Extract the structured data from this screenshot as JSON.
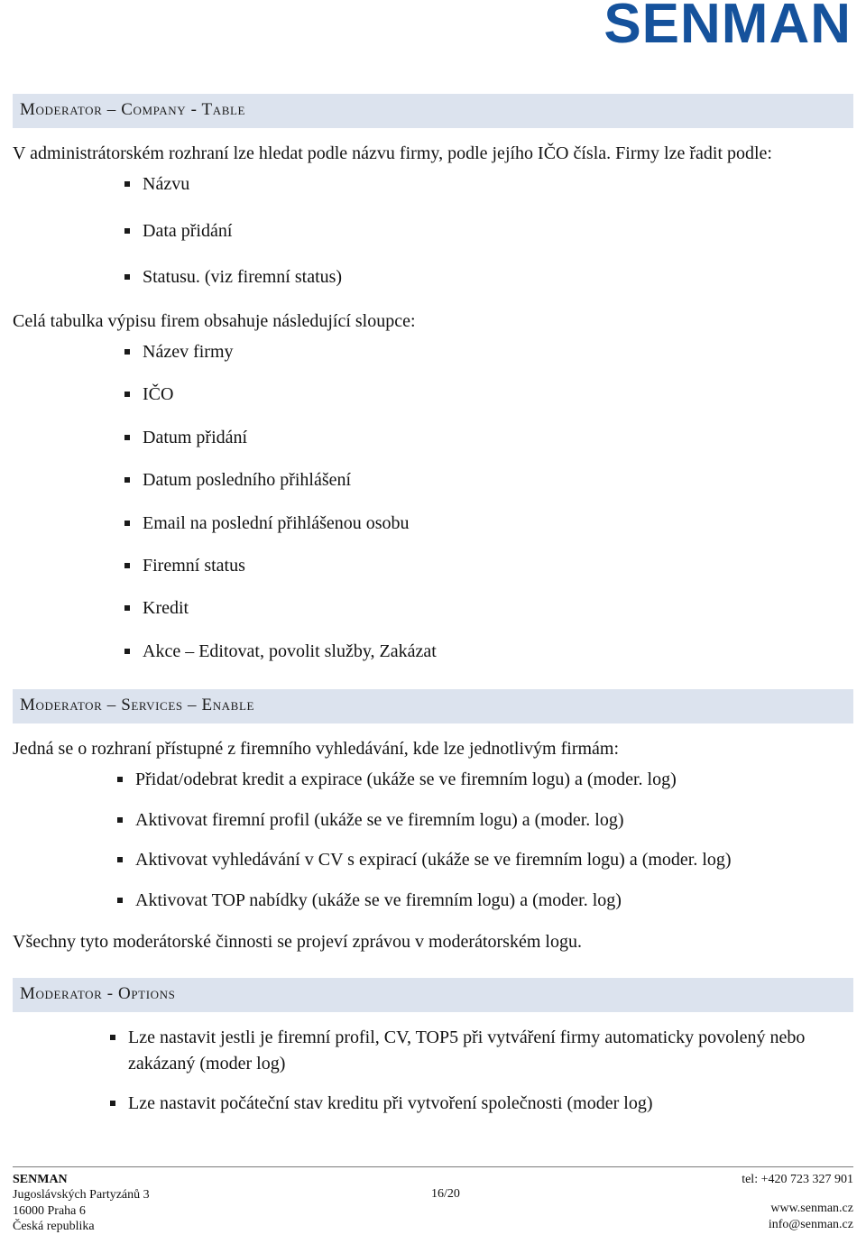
{
  "brand": {
    "logo_text": "SENMAN",
    "logo_color": "#15529c"
  },
  "band_color": "#dce3ee",
  "sections": {
    "company_table": {
      "heading": "Moderator – Company - Table",
      "intro": "V administrátorském rozhraní lze hledat podle názvu firmy, podle jejího IČO čísla. Firmy lze řadit podle:",
      "sort_options": [
        "Názvu",
        "Data přidání",
        "Statusu. (viz firemní status)"
      ],
      "columns_intro": "Celá tabulka výpisu firem obsahuje následující sloupce:",
      "columns": [
        "Název firmy",
        "IČO",
        "Datum přidání",
        "Datum posledního přihlášení",
        "Email na poslední přihlášenou osobu",
        "Firemní status",
        "Kredit",
        "Akce – Editovat, povolit služby, Zakázat"
      ]
    },
    "services_enable": {
      "heading": "Moderator – Services – Enable",
      "intro": "Jedná se o rozhraní přístupné z firemního vyhledávání, kde lze jednotlivým firmám:",
      "items": [
        "Přidat/odebrat kredit a expirace (ukáže se ve firemním logu) a (moder. log)",
        "Aktivovat firemní profil (ukáže se ve firemním logu) a (moder. log)",
        "Aktivovat vyhledávání v CV s expirací (ukáže se ve firemním logu) a (moder. log)",
        "Aktivovat TOP nabídky (ukáže se ve firemním logu) a (moder. log)"
      ],
      "outro": "Všechny tyto moderátorské činnosti se projeví zprávou v moderátorském logu."
    },
    "options": {
      "heading": "Moderator - Options",
      "items": [
        "Lze nastavit jestli je firemní profil, CV, TOP5 při vytváření firmy automaticky povolený nebo zakázaný (moder log)",
        "Lze nastavit počáteční stav kreditu při vytvoření společnosti  (moder log)"
      ]
    }
  },
  "footer": {
    "company": "SENMAN",
    "street": "Jugoslávských Partyzánů 3",
    "city": "16000 Praha 6",
    "country": "Česká republika",
    "page_number": "16/20",
    "tel": "tel: +420 723 327 901",
    "web": "www.senman.cz",
    "email": "info@senman.cz"
  }
}
